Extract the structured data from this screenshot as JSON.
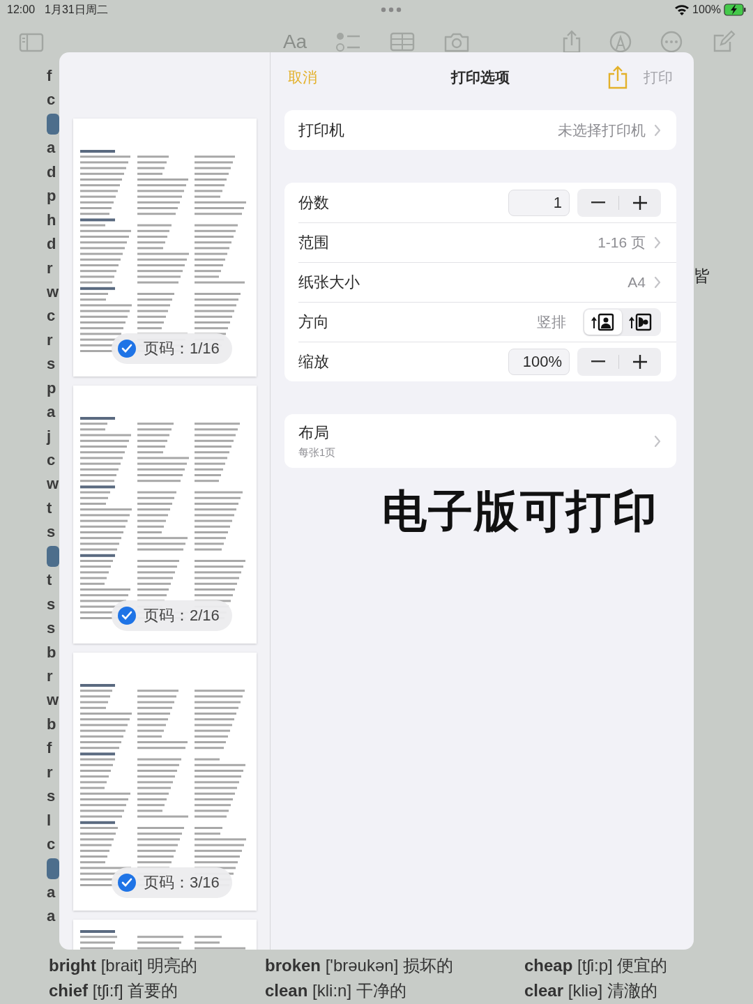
{
  "status_bar": {
    "time": "12:00",
    "date": "1月31日周二",
    "battery": "100%",
    "charging": true
  },
  "toolbar": {
    "format_label": "Aa"
  },
  "note_left_edge": [
    {
      "kind": "text",
      "text": "f"
    },
    {
      "kind": "text",
      "text": "c"
    },
    {
      "kind": "tag"
    },
    {
      "kind": "text",
      "text": "a"
    },
    {
      "kind": "text",
      "text": "d"
    },
    {
      "kind": "text",
      "text": "p"
    },
    {
      "kind": "text",
      "text": "h"
    },
    {
      "kind": "text",
      "text": "d"
    },
    {
      "kind": "text",
      "text": "r"
    },
    {
      "kind": "text",
      "text": "w"
    },
    {
      "kind": "text",
      "text": "c"
    },
    {
      "kind": "text",
      "text": "r"
    },
    {
      "kind": "text",
      "text": "s"
    },
    {
      "kind": "text",
      "text": "p"
    },
    {
      "kind": "text",
      "text": "a"
    },
    {
      "kind": "text",
      "text": "j"
    },
    {
      "kind": "text",
      "text": "c"
    },
    {
      "kind": "text",
      "text": "w"
    },
    {
      "kind": "text",
      "text": "t"
    },
    {
      "kind": "text",
      "text": "s"
    },
    {
      "kind": "tag"
    },
    {
      "kind": "text",
      "text": "t"
    },
    {
      "kind": "text",
      "text": "s"
    },
    {
      "kind": "text",
      "text": "s"
    },
    {
      "kind": "text",
      "text": "b"
    },
    {
      "kind": "text",
      "text": "r"
    },
    {
      "kind": "text",
      "text": "w"
    },
    {
      "kind": "text",
      "text": "b"
    },
    {
      "kind": "text",
      "text": "f"
    },
    {
      "kind": "text",
      "text": "r"
    },
    {
      "kind": "text",
      "text": "s"
    },
    {
      "kind": "text",
      "text": "l"
    },
    {
      "kind": "text",
      "text": "c"
    },
    {
      "kind": "tag"
    },
    {
      "kind": "text",
      "text": "a"
    },
    {
      "kind": "text",
      "text": "a"
    }
  ],
  "note_right_edge": "皆",
  "note_bottom_rows": [
    [
      "**bright** [brait] 明亮的",
      "**broken** ['brəukən] 损坏的",
      "**cheap** [tʃi:p] 便宜的"
    ],
    [
      "**chief** [tʃi:f] 首要的",
      "**clean** [kli:n] 干净的",
      "**clear** [kliə] 清澈的"
    ]
  ],
  "previews": {
    "pages": [
      {
        "badge": "页码：1/16",
        "checked": true
      },
      {
        "badge": "页码：2/16",
        "checked": true
      },
      {
        "badge": "页码：3/16",
        "checked": true
      }
    ],
    "more_pages_below": true
  },
  "print_options": {
    "cancel": "取消",
    "title": "打印选项",
    "print": {
      "label": "打印",
      "disabled": true
    },
    "printer": {
      "label": "打印机",
      "value": "未选择打印机"
    },
    "settings": [
      {
        "kind": "stepper",
        "label": "份数",
        "value": "1"
      },
      {
        "kind": "link",
        "label": "范围",
        "value": "1-16 页"
      },
      {
        "kind": "link",
        "label": "纸张大小",
        "value": "A4"
      },
      {
        "kind": "orientation",
        "label": "方向",
        "value": "竖排",
        "options": [
          {
            "kind": "portrait",
            "selected": true
          },
          {
            "kind": "landscape",
            "selected": false
          }
        ]
      },
      {
        "kind": "stepper",
        "label": "缩放",
        "value": "100%"
      }
    ],
    "layout": {
      "label": "布局",
      "subtitle": "每张1页"
    }
  },
  "overlay_caption": "电子版可打印"
}
